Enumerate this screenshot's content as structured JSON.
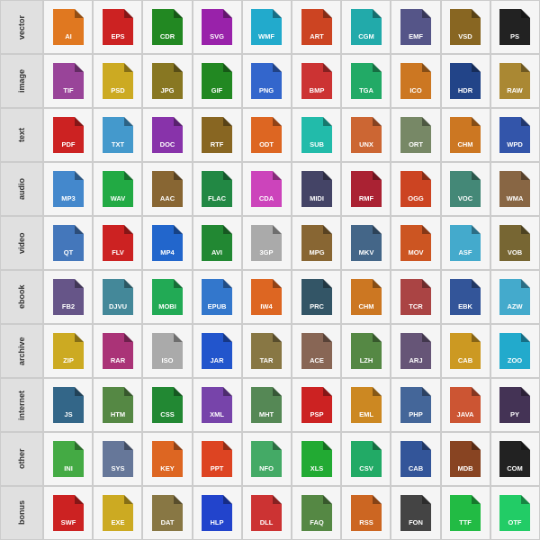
{
  "categories": [
    {
      "id": "vector",
      "label": "vector"
    },
    {
      "id": "image",
      "label": "image"
    },
    {
      "id": "text",
      "label": "text"
    },
    {
      "id": "audio",
      "label": "audio"
    },
    {
      "id": "video",
      "label": "video"
    },
    {
      "id": "ebook",
      "label": "ebook"
    },
    {
      "id": "archive",
      "label": "archive"
    },
    {
      "id": "internet",
      "label": "internet"
    },
    {
      "id": "other",
      "label": "other"
    },
    {
      "id": "bonus",
      "label": "bonus"
    }
  ],
  "rows": [
    [
      {
        "ext": "AI",
        "color": "#e07820"
      },
      {
        "ext": "EPS",
        "color": "#cc2222"
      },
      {
        "ext": "CDR",
        "color": "#228822"
      },
      {
        "ext": "SVG",
        "color": "#9922aa"
      },
      {
        "ext": "WMF",
        "color": "#22aacc"
      },
      {
        "ext": "ART",
        "color": "#cc4422"
      },
      {
        "ext": "CGM",
        "color": "#22aaaa"
      },
      {
        "ext": "EMF",
        "color": "#555588"
      },
      {
        "ext": "VSD",
        "color": "#886622"
      },
      {
        "ext": "PS",
        "color": "#222222"
      }
    ],
    [
      {
        "ext": "TIF",
        "color": "#994499"
      },
      {
        "ext": "PSD",
        "color": "#ccaa22"
      },
      {
        "ext": "JPG",
        "color": "#887722"
      },
      {
        "ext": "GIF",
        "color": "#228822"
      },
      {
        "ext": "PNG",
        "color": "#3366cc"
      },
      {
        "ext": "BMP",
        "color": "#cc3333"
      },
      {
        "ext": "TGA",
        "color": "#22aa66"
      },
      {
        "ext": "ICO",
        "color": "#cc7722"
      },
      {
        "ext": "HDR",
        "color": "#224488"
      },
      {
        "ext": "RAW",
        "color": "#aa8833"
      }
    ],
    [
      {
        "ext": "PDF",
        "color": "#cc2222"
      },
      {
        "ext": "TXT",
        "color": "#4499cc"
      },
      {
        "ext": "DOC",
        "color": "#8833aa"
      },
      {
        "ext": "RTF",
        "color": "#886622"
      },
      {
        "ext": "ODT",
        "color": "#dd6622"
      },
      {
        "ext": "SUB",
        "color": "#22bbaa"
      },
      {
        "ext": "UNX",
        "color": "#cc6633"
      },
      {
        "ext": "ORT",
        "color": "#778866"
      },
      {
        "ext": "CHM",
        "color": "#cc7722"
      },
      {
        "ext": "WPD",
        "color": "#3355aa"
      }
    ],
    [
      {
        "ext": "MP3",
        "color": "#4488cc"
      },
      {
        "ext": "WAV",
        "color": "#22aa44"
      },
      {
        "ext": "AAC",
        "color": "#886633"
      },
      {
        "ext": "FLAC",
        "color": "#228844"
      },
      {
        "ext": "CDA",
        "color": "#cc44bb"
      },
      {
        "ext": "MIDI",
        "color": "#444466"
      },
      {
        "ext": "RMF",
        "color": "#aa2233"
      },
      {
        "ext": "OGG",
        "color": "#cc4422"
      },
      {
        "ext": "VOC",
        "color": "#448877"
      },
      {
        "ext": "WMA",
        "color": "#886644"
      }
    ],
    [
      {
        "ext": "QT",
        "color": "#4477bb"
      },
      {
        "ext": "FLV",
        "color": "#cc2222"
      },
      {
        "ext": "MP4",
        "color": "#2266cc"
      },
      {
        "ext": "AVI",
        "color": "#228833"
      },
      {
        "ext": "3GP",
        "color": "#aaaaaa"
      },
      {
        "ext": "MPG",
        "color": "#886633"
      },
      {
        "ext": "MKV",
        "color": "#446688"
      },
      {
        "ext": "MOV",
        "color": "#cc5522"
      },
      {
        "ext": "ASF",
        "color": "#44aacc"
      },
      {
        "ext": "VOB",
        "color": "#776633"
      }
    ],
    [
      {
        "ext": "FB2",
        "color": "#665588"
      },
      {
        "ext": "DJVU",
        "color": "#448899"
      },
      {
        "ext": "MOBI",
        "color": "#22aa55"
      },
      {
        "ext": "EPUB",
        "color": "#3377cc"
      },
      {
        "ext": "IW4",
        "color": "#dd6622"
      },
      {
        "ext": "PRC",
        "color": "#335566"
      },
      {
        "ext": "CHM",
        "color": "#cc7722"
      },
      {
        "ext": "TCR",
        "color": "#aa4444"
      },
      {
        "ext": "EBK",
        "color": "#335599"
      },
      {
        "ext": "AZW",
        "color": "#44aacc"
      }
    ],
    [
      {
        "ext": "ZIP",
        "color": "#ccaa22"
      },
      {
        "ext": "RAR",
        "color": "#aa3377"
      },
      {
        "ext": "ISO",
        "color": "#aaaaaa"
      },
      {
        "ext": "JAR",
        "color": "#2255cc"
      },
      {
        "ext": "TAR",
        "color": "#887744"
      },
      {
        "ext": "ACE",
        "color": "#886655"
      },
      {
        "ext": "LZH",
        "color": "#558844"
      },
      {
        "ext": "ARJ",
        "color": "#665577"
      },
      {
        "ext": "CAB",
        "color": "#cc9922"
      },
      {
        "ext": "ZOO",
        "color": "#22aacc"
      }
    ],
    [
      {
        "ext": "JS",
        "color": "#336688"
      },
      {
        "ext": "HTM",
        "color": "#558844"
      },
      {
        "ext": "CSS",
        "color": "#228833"
      },
      {
        "ext": "XML",
        "color": "#7744aa"
      },
      {
        "ext": "MHT",
        "color": "#558855"
      },
      {
        "ext": "PSP",
        "color": "#cc2222"
      },
      {
        "ext": "EML",
        "color": "#cc8822"
      },
      {
        "ext": "PHP",
        "color": "#446699"
      },
      {
        "ext": "JAVA",
        "color": "#cc5533"
      },
      {
        "ext": "PY",
        "color": "#443355"
      }
    ],
    [
      {
        "ext": "INI",
        "color": "#44aa44"
      },
      {
        "ext": "SYS",
        "color": "#667799"
      },
      {
        "ext": "KEY",
        "color": "#dd6622"
      },
      {
        "ext": "PPT",
        "color": "#dd4422"
      },
      {
        "ext": "NFO",
        "color": "#44aa66"
      },
      {
        "ext": "XLS",
        "color": "#22aa33"
      },
      {
        "ext": "CSV",
        "color": "#22aa66"
      },
      {
        "ext": "CAB",
        "color": "#335599"
      },
      {
        "ext": "MDB",
        "color": "#884422"
      },
      {
        "ext": "COM",
        "color": "#222222"
      }
    ],
    [
      {
        "ext": "SWF",
        "color": "#cc2222"
      },
      {
        "ext": "EXE",
        "color": "#ccaa22"
      },
      {
        "ext": "DAT",
        "color": "#887744"
      },
      {
        "ext": "HLP",
        "color": "#2244cc"
      },
      {
        "ext": "DLL",
        "color": "#cc3333"
      },
      {
        "ext": "FAQ",
        "color": "#558844"
      },
      {
        "ext": "RSS",
        "color": "#cc6622"
      },
      {
        "ext": "FON",
        "color": "#444444"
      },
      {
        "ext": "TTF",
        "color": "#22bb44"
      },
      {
        "ext": "OTF",
        "color": "#22cc66"
      }
    ]
  ]
}
